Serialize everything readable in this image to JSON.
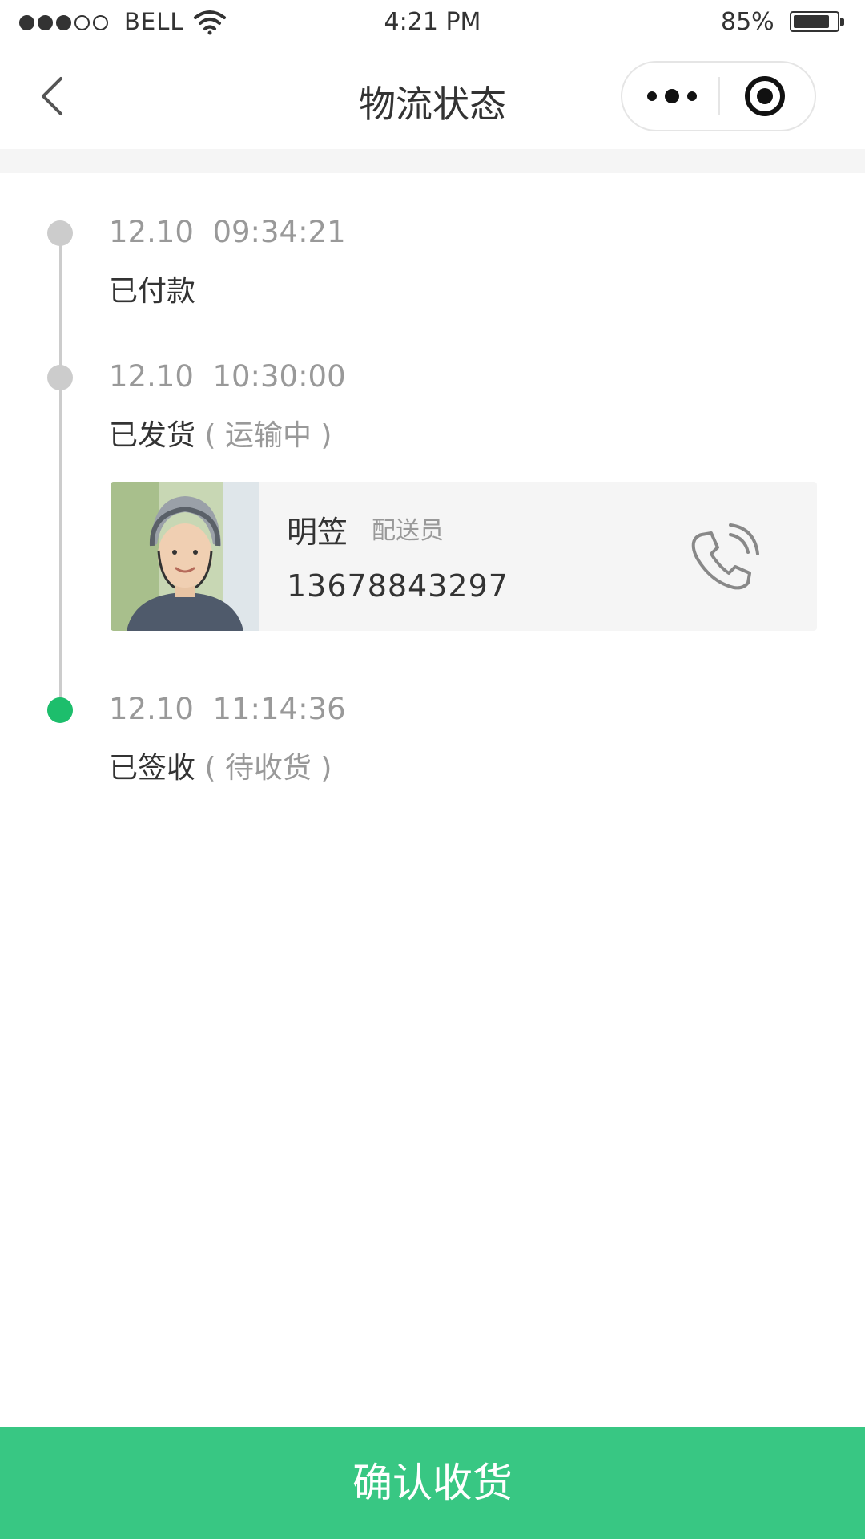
{
  "status_bar": {
    "carrier": "BELL",
    "time": "4:21 PM",
    "battery_percent": "85%",
    "battery_level": 0.85,
    "signal_bars": 3
  },
  "nav": {
    "title": "物流状态",
    "back_icon": "chevron-left-icon",
    "more_icon": "more-dots-icon",
    "close_icon": "target-circle-icon"
  },
  "timeline": [
    {
      "time": "12.10  09:34:21",
      "status": "已付款",
      "note": "",
      "active": false
    },
    {
      "time": "12.10  10:30:00",
      "status": "已发货",
      "note": "( 运输中 )",
      "active": false
    },
    {
      "time": "12.10  11:14:36",
      "status": "已签收",
      "note": "( 待收货 )",
      "active": true
    }
  ],
  "courier": {
    "name": "明笠",
    "role": "配送员",
    "phone": "13678843297",
    "call_icon": "phone-icon"
  },
  "confirm_button": "确认收货",
  "colors": {
    "accent": "#38c783",
    "active_dot": "#1dbe6c",
    "inactive_dot": "#cccccc",
    "card_bg": "#f5f5f5"
  }
}
